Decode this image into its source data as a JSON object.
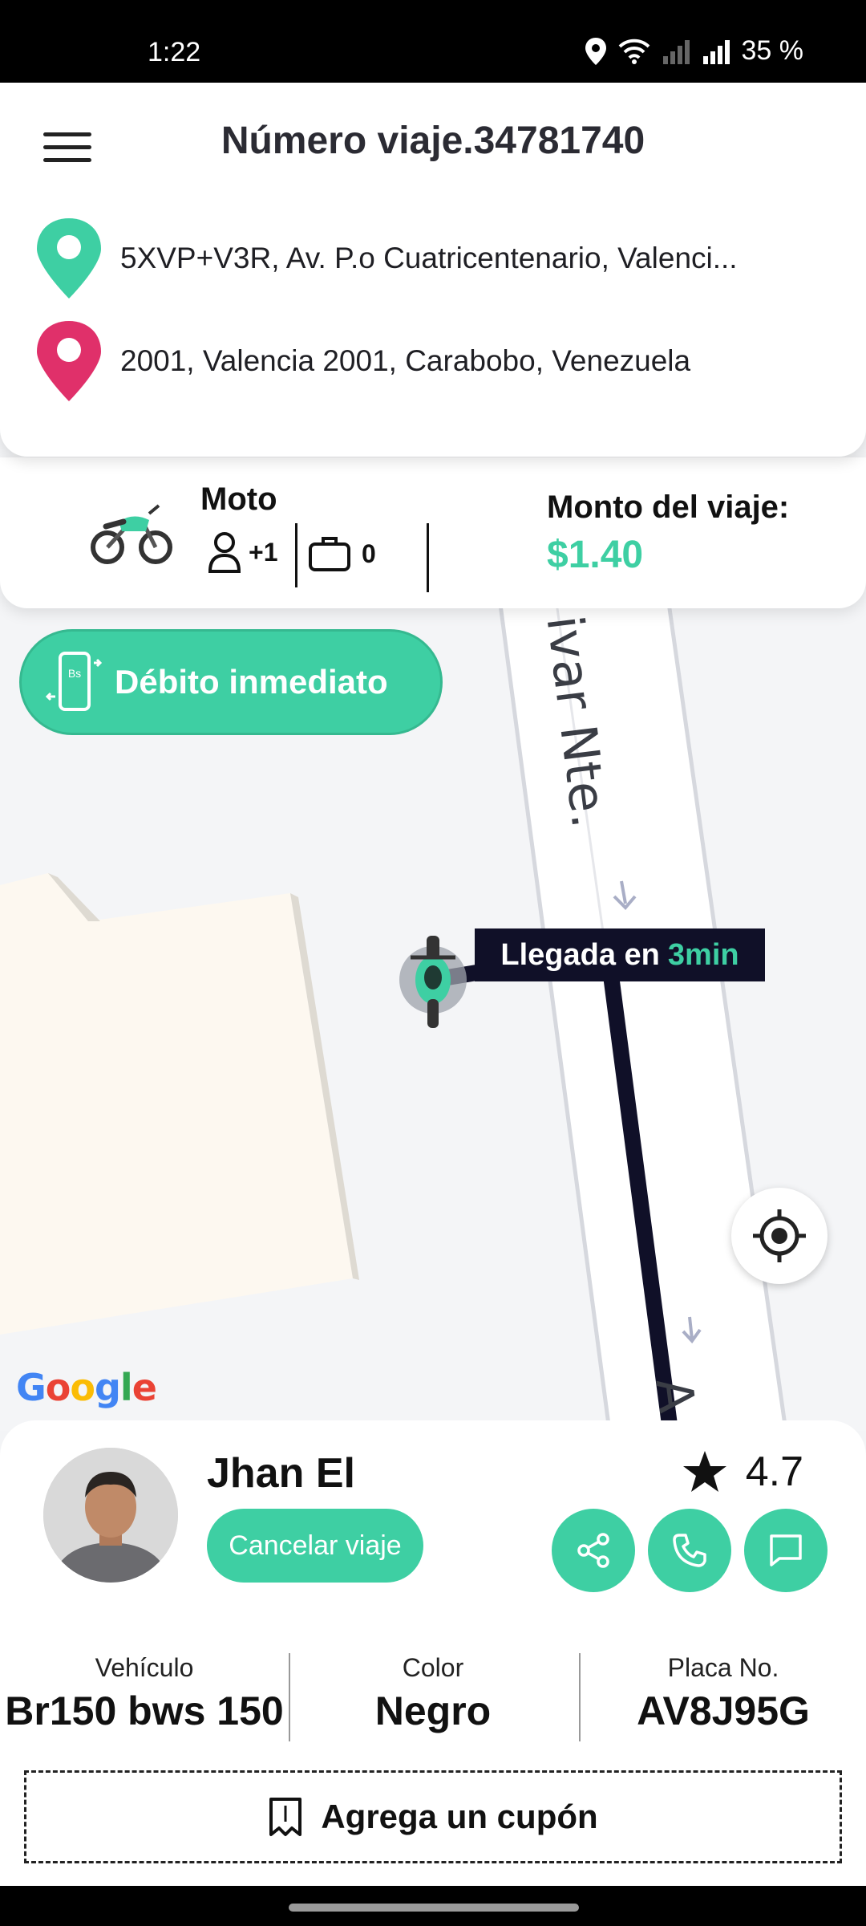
{
  "status_bar": {
    "time": "1:22",
    "battery": "35 %"
  },
  "header": {
    "trip_title": "Número viaje.34781740",
    "origin": "5XVP+V3R, Av. P.o Cuatricentenario, Valenci...",
    "destination": "2001, Valencia 2001, Carabobo, Venezuela"
  },
  "trip_info": {
    "vehicle_type": "Moto",
    "passengers": "+1",
    "luggage": "0",
    "fare_label": "Monto del viaje:",
    "fare_value": "$1.40"
  },
  "payment": {
    "label": "Débito inmediato",
    "icon_text": "Bs"
  },
  "map": {
    "street_label": "ivar Nte.",
    "street_label_2": "A",
    "eta_prefix": "Llegada en",
    "eta_value": "3min",
    "google_logo": [
      "G",
      "o",
      "o",
      "g",
      "l",
      "e"
    ]
  },
  "driver": {
    "name": "Jhan El",
    "rating": "4.7",
    "cancel_label": "Cancelar viaje"
  },
  "vehicle_details": {
    "vehicle_label": "Vehículo",
    "vehicle_value": "Br150 bws 150",
    "color_label": "Color",
    "color_value": "Negro",
    "plate_label": "Placa No.",
    "plate_value": "AV8J95G"
  },
  "coupon": {
    "label": "Agrega un cupón"
  },
  "colors": {
    "accent": "#3ecfa3",
    "origin_pin": "#3ecfa3",
    "destination_pin": "#e0306a",
    "route": "#101028"
  }
}
